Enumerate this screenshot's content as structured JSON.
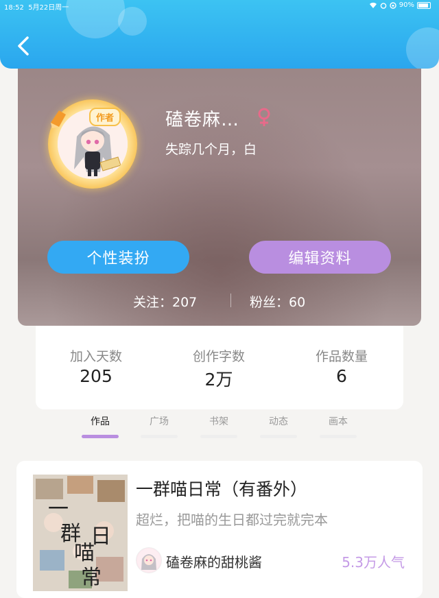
{
  "status_bar": {
    "time": "18:52",
    "date": "5月22日周一",
    "battery": "90%"
  },
  "profile": {
    "author_badge": "作者",
    "username": "磕卷麻…",
    "signature": "失踪几个月，白",
    "dress_button": "个性装扮",
    "edit_button": "编辑资料",
    "following": "关注：207",
    "followers": "粉丝：60"
  },
  "stats": [
    {
      "label": "加入天数",
      "value": "205"
    },
    {
      "label": "创作字数",
      "value": "2万"
    },
    {
      "label": "作品数量",
      "value": "6"
    }
  ],
  "tabs": [
    {
      "label": "作品",
      "active": true
    },
    {
      "label": "广场",
      "active": false
    },
    {
      "label": "书架",
      "active": false
    },
    {
      "label": "动态",
      "active": false
    },
    {
      "label": "画本",
      "active": false
    }
  ],
  "work": {
    "title": "一群喵日常（有番外）",
    "description": "超烂，把喵的生日都过完就完本",
    "author": "磕卷麻的甜桃酱",
    "popularity": "5.3万人气",
    "cover_text": "一群喵日常"
  },
  "colors": {
    "header": "#2aa6ee",
    "dress_button": "#33a9f3",
    "edit_button": "#b98ee0",
    "popularity": "#c49ae6"
  }
}
